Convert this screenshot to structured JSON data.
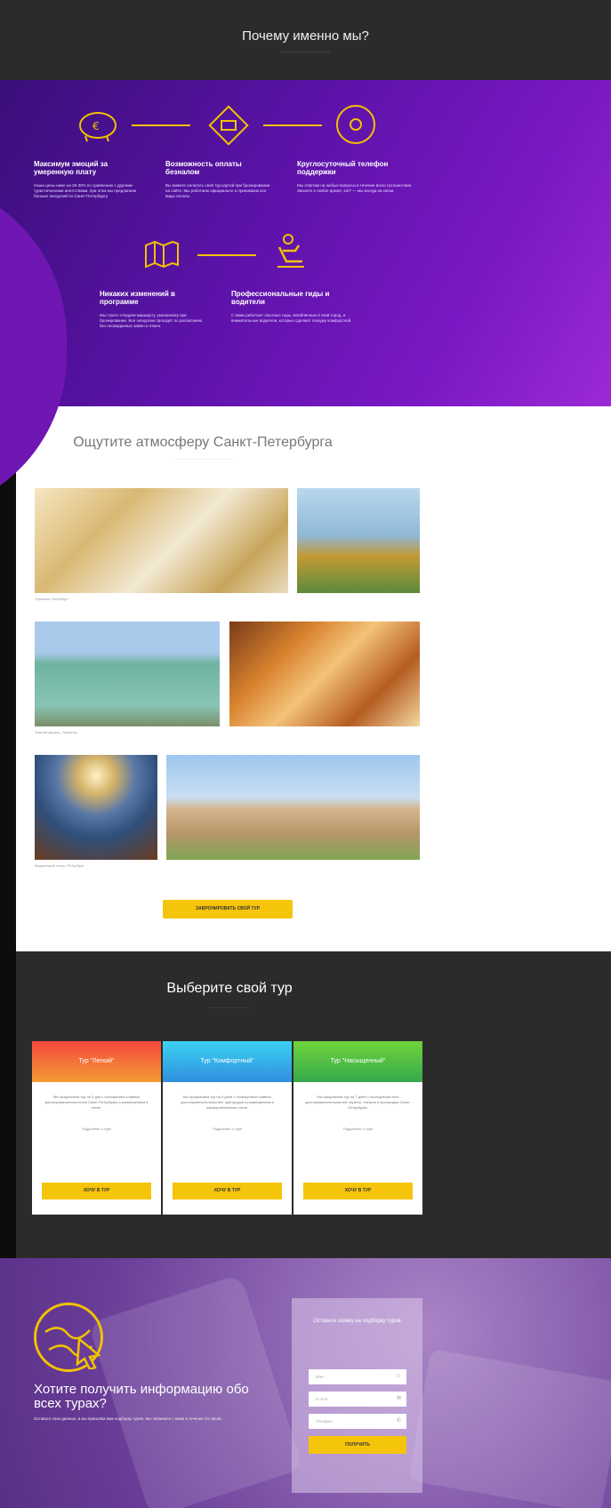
{
  "why": {
    "title": "Почему именно мы?",
    "subtitle": "———————————",
    "features": [
      {
        "title": "Максимум эмоций за умеренную плату",
        "desc": "Наши цены ниже на 25-30% по сравнению с другими туристическими агентствами, при этом мы предлагаем больше экскурсий по Санкт-Петербургу."
      },
      {
        "title": "Возможность оплаты безналом",
        "desc": "Вы можете оплатить свой тур картой при бронировании на сайте. Мы работаем официально и принимаем все виды оплаты."
      },
      {
        "title": "Круглосуточный телефон поддержки",
        "desc": "Мы ответим на любые вопросы в течение всего путешествия. Звоните в любое время, 24/7 — мы всегда на связи."
      },
      {
        "title": "Никаких изменений в программе",
        "desc": "Мы строго следуем маршруту, указанному при бронировании. Все экскурсии проходят по расписанию, без неожиданных замен и отмен."
      },
      {
        "title": "Профессиональные гиды и водители",
        "desc": "С вами работают опытные гиды, влюблённые в свой город, и внимательные водители, которые сделают поездку комфортной."
      }
    ]
  },
  "gallery": {
    "title": "Ощутите атмосферу Санкт-Петербурга",
    "subtitle": "~~~~~~~~~~~~~~~~~~~~~~~~~~~~",
    "captions": [
      "Эрмитаж, Петербург",
      "Зимний дворец, Эрмитаж",
      "Мариинский театр, Петербург"
    ],
    "cta": "ЗАБРОНИРОВАТЬ СВОЙ ТУР"
  },
  "tours": {
    "title": "Выберите свой тур",
    "subtitle": "————————————",
    "cards": [
      {
        "name": "Тур \"Легкий\"",
        "color": "#f06a3a",
        "text": "Мы предлагаем тур на 3 дня с посещением главных достопримечательностей Санкт-Петербурга и размещением в отеле.",
        "link": "Подробнее о туре",
        "btn": "ХОЧУ В ТУР"
      },
      {
        "name": "Тур \"Комфортный\"",
        "color": "#35b8ea",
        "text": "Мы предлагаем тур на 5 дней с посещением главных достопримечательностей, пригородов и размещением в комфортабельном отеле.",
        "link": "Подробнее о туре",
        "btn": "ХОЧУ В ТУР"
      },
      {
        "name": "Тур \"Насыщенный\"",
        "color": "#5cbe3c",
        "text": "Мы предлагаем тур на 7 дней с посещением всех достопримечательностей, музеев, театров и пригородов Санкт-Петербурга.",
        "link": "Подробнее о туре",
        "btn": "ХОЧУ В ТУР"
      }
    ]
  },
  "footer": {
    "title": "Хотите получить информацию обо всех турах?",
    "subtitle": "Оставьте свои данные, и мы пришлём вам подборку туров. Мы свяжемся с вами в течение 24 часов.",
    "form_title": "Оставьте заявку на подборку туров",
    "fields": [
      {
        "placeholder": "Имя",
        "icon": "user-icon"
      },
      {
        "placeholder": "E-mail",
        "icon": "mail-icon"
      },
      {
        "placeholder": "Телефон",
        "icon": "phone-icon"
      }
    ],
    "button": "ПОЛУЧИТЬ"
  }
}
